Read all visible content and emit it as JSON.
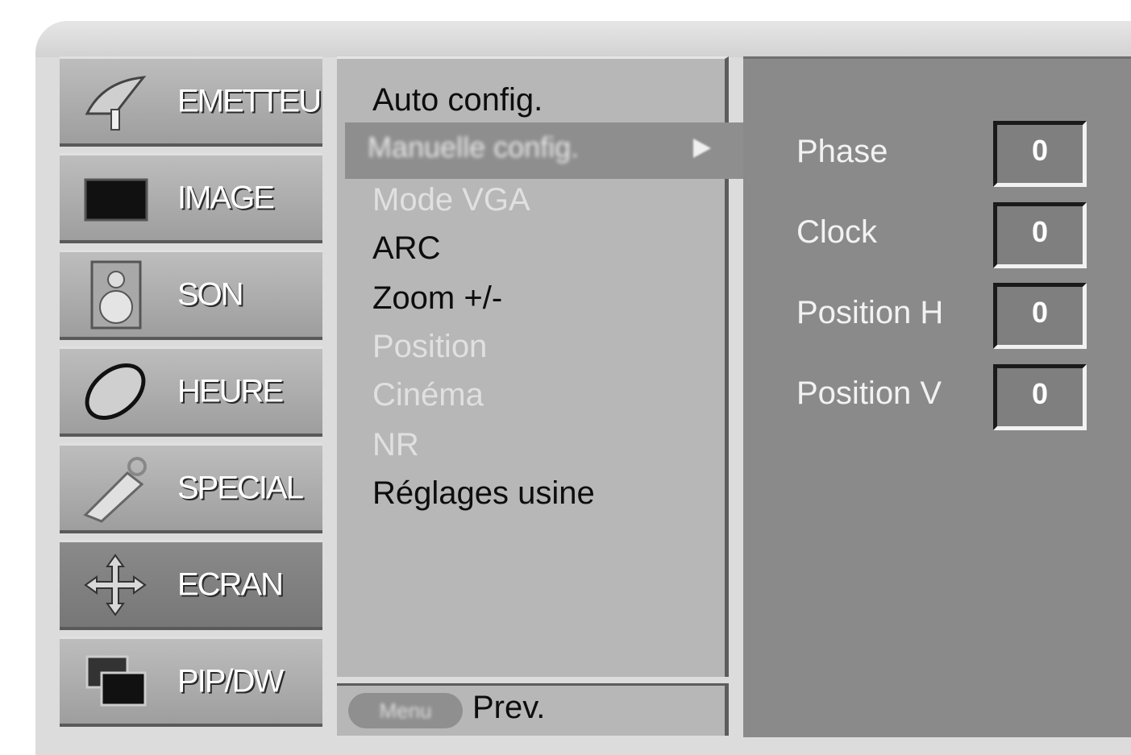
{
  "categories": [
    {
      "label": "EMETTEUR",
      "icon": "satellite-dish-icon",
      "active": false
    },
    {
      "label": "IMAGE",
      "icon": "screen-icon",
      "active": false
    },
    {
      "label": "SON",
      "icon": "speaker-icon",
      "active": false
    },
    {
      "label": "HEURE",
      "icon": "clock-icon",
      "active": false
    },
    {
      "label": "SPECIAL",
      "icon": "key-tag-icon",
      "active": false
    },
    {
      "label": "ECRAN",
      "icon": "move-arrows-icon",
      "active": true
    },
    {
      "label": "PIP/DW",
      "icon": "pip-windows-icon",
      "active": false
    }
  ],
  "menu": {
    "items": [
      {
        "label": "Auto config.",
        "state": "normal"
      },
      {
        "label": "Manuelle config.",
        "state": "selected"
      },
      {
        "label": "Mode VGA",
        "state": "disabled"
      },
      {
        "label": "ARC",
        "state": "normal"
      },
      {
        "label": "Zoom +/-",
        "state": "normal"
      },
      {
        "label": "Position",
        "state": "disabled"
      },
      {
        "label": "Cinéma",
        "state": "disabled"
      },
      {
        "label": "NR",
        "state": "disabled"
      },
      {
        "label": "Réglages usine",
        "state": "normal"
      }
    ],
    "footer_button": "Menu",
    "footer_label": "Prev."
  },
  "params": [
    {
      "label": "Phase",
      "value": "0"
    },
    {
      "label": "Clock",
      "value": "0"
    },
    {
      "label": "Position H",
      "value": "0"
    },
    {
      "label": "Position V",
      "value": "0"
    }
  ],
  "colors": {
    "panel": "#8a8a8a",
    "menu": "#b7b7b7",
    "highlight": "#8e8e8e"
  }
}
